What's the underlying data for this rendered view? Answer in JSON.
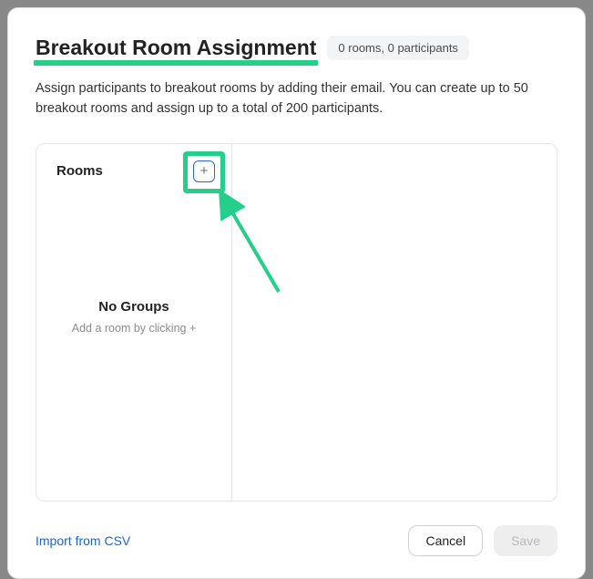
{
  "header": {
    "title": "Breakout Room Assignment",
    "counts_badge": "0 rooms, 0 participants",
    "description": "Assign participants to breakout rooms by adding their email. You can create up to 50 breakout rooms and assign up to a total of 200 participants."
  },
  "sidebar": {
    "title": "Rooms",
    "add_icon_glyph": "+",
    "empty_title": "No Groups",
    "empty_sub": "Add a room by clicking +"
  },
  "footer": {
    "import_label": "Import from CSV",
    "cancel_label": "Cancel",
    "save_label": "Save"
  },
  "annotation": {
    "highlight_color": "#23cf8a"
  }
}
